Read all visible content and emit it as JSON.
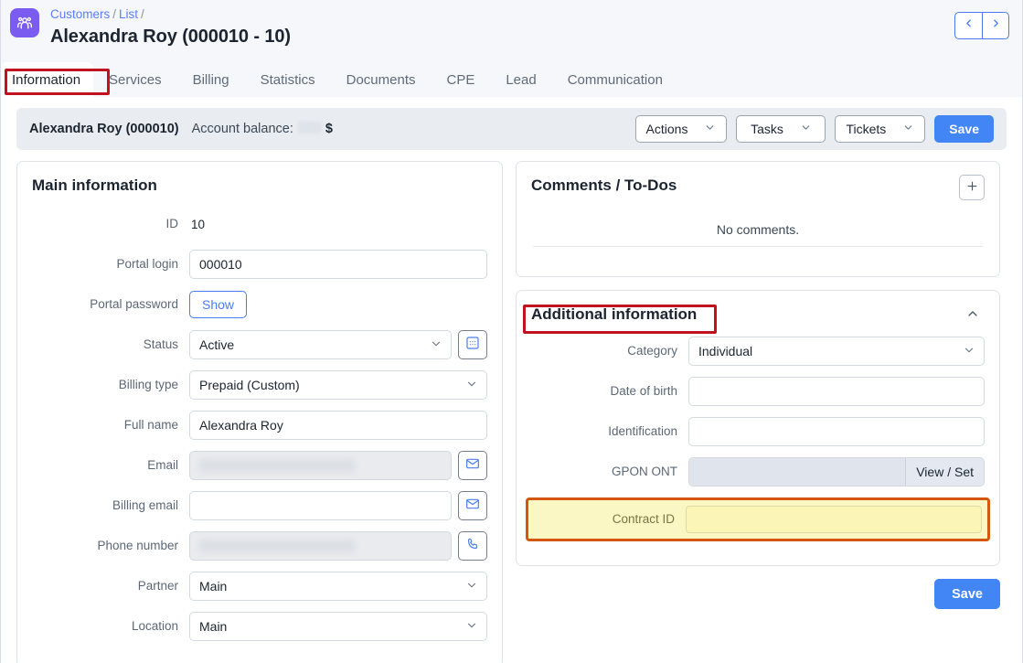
{
  "header": {
    "app_icon": "people-group-icon",
    "breadcrumb": [
      {
        "label": "Customers",
        "link": true
      },
      {
        "label": "List",
        "link": true
      }
    ],
    "breadcrumb_separator": "/",
    "title": "Alexandra Roy (000010 - 10)",
    "nav_prev_icon": "chevron-left-icon",
    "nav_next_icon": "chevron-right-icon"
  },
  "tabs": [
    {
      "label": "Information",
      "active": true
    },
    {
      "label": "Services",
      "active": false
    },
    {
      "label": "Billing",
      "active": false
    },
    {
      "label": "Statistics",
      "active": false
    },
    {
      "label": "Documents",
      "active": false
    },
    {
      "label": "CPE",
      "active": false
    },
    {
      "label": "Lead",
      "active": false
    },
    {
      "label": "Communication",
      "active": false
    }
  ],
  "subbar": {
    "customer_name": "Alexandra Roy (000010)",
    "balance_label": "Account balance:",
    "balance_value": "",
    "currency": "$",
    "actions_label": "Actions",
    "tasks_label": "Tasks",
    "tickets_label": "Tickets",
    "save_label": "Save"
  },
  "main_information": {
    "title": "Main information",
    "fields": {
      "id_label": "ID",
      "id_value": "10",
      "portal_login_label": "Portal login",
      "portal_login_value": "000010",
      "portal_password_label": "Portal password",
      "portal_password_button": "Show",
      "status_label": "Status",
      "status_value": "Active",
      "status_extra_icon": "grid-picker-icon",
      "billing_type_label": "Billing type",
      "billing_type_value": "Prepaid (Custom)",
      "full_name_label": "Full name",
      "full_name_value": "Alexandra Roy",
      "email_label": "Email",
      "email_value": "",
      "email_icon": "envelope-icon",
      "billing_email_label": "Billing email",
      "billing_email_value": "",
      "billing_email_icon": "envelope-icon",
      "phone_label": "Phone number",
      "phone_value": "",
      "phone_icon": "phone-icon",
      "partner_label": "Partner",
      "partner_value": "Main",
      "location_label": "Location",
      "location_value": "Main"
    }
  },
  "comments": {
    "title": "Comments / To-Dos",
    "add_icon": "plus-icon",
    "empty_text": "No comments."
  },
  "additional_information": {
    "title": "Additional information",
    "collapse_icon": "chevron-up-icon",
    "fields": {
      "category_label": "Category",
      "category_value": "Individual",
      "date_of_birth_label": "Date of birth",
      "date_of_birth_value": "",
      "identification_label": "Identification",
      "identification_value": "",
      "gpon_ont_label": "GPON ONT",
      "gpon_ont_value": "",
      "gpon_ont_button": "View / Set",
      "contract_id_label": "Contract ID",
      "contract_id_value": ""
    },
    "save_label": "Save"
  },
  "colors": {
    "accent_blue": "#4285f4",
    "link_blue": "#5b7cfa",
    "app_icon_purple": "#7b5cf0",
    "annotation_red": "#c1121f",
    "highlight_yellow": "#fbf7c4",
    "highlight_orange_border": "#d4570f",
    "page_bg": "#f5f7fa",
    "subbar_bg": "#e9edf2"
  }
}
